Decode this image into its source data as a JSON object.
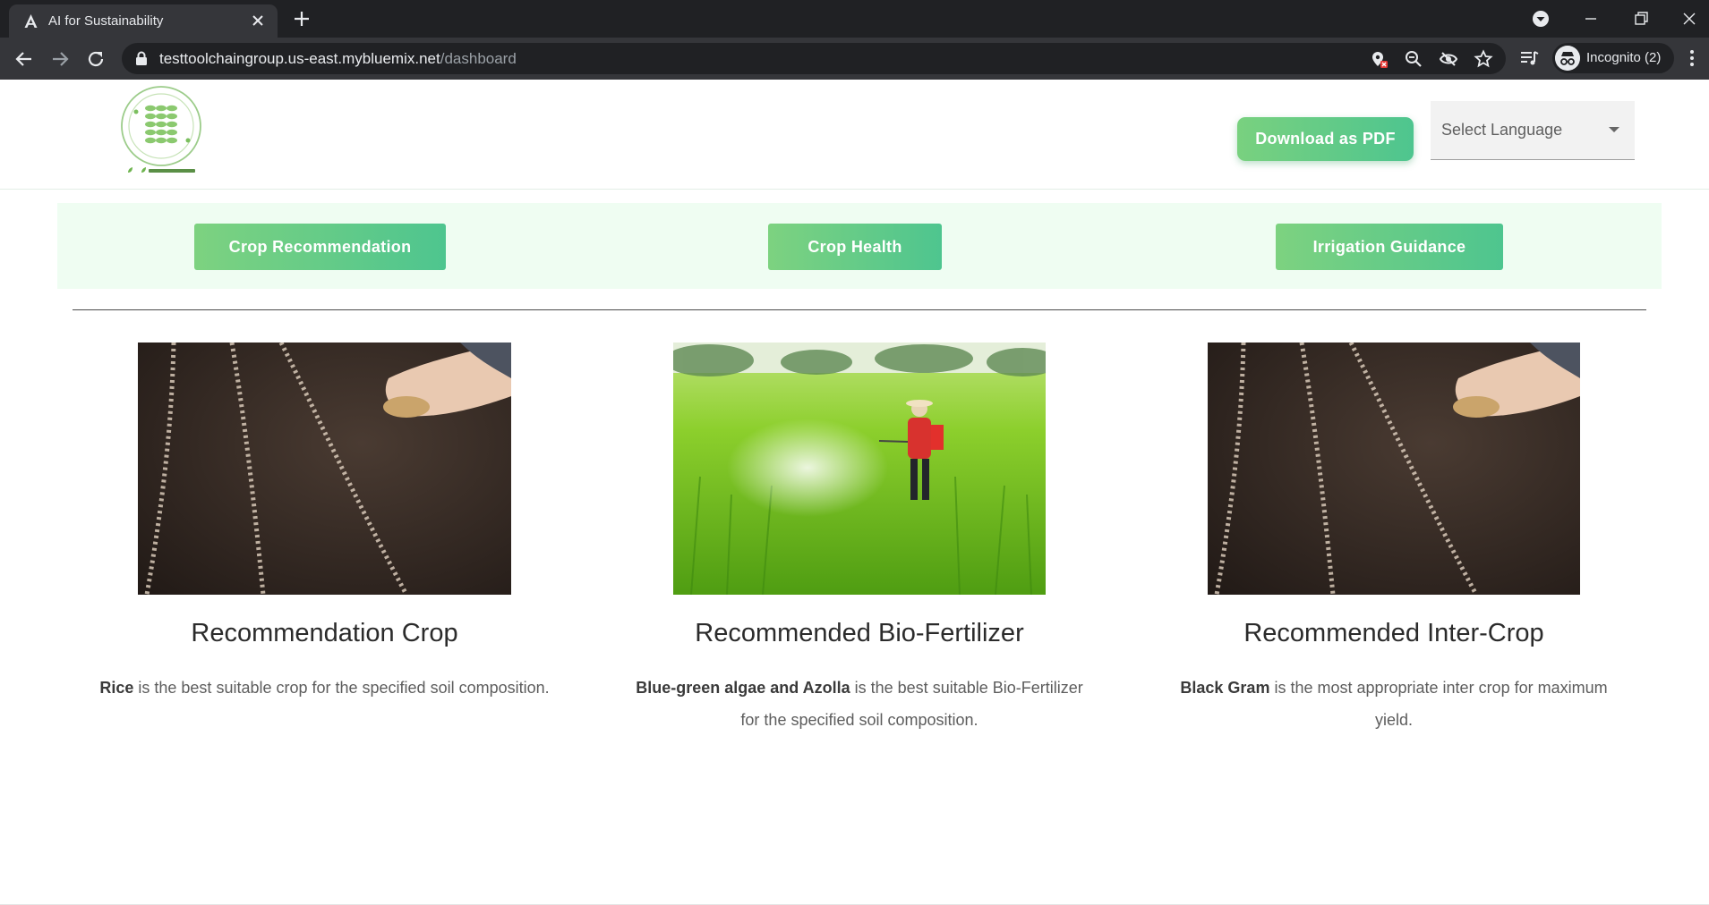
{
  "browser": {
    "tab_title": "AI for Sustainability",
    "url_host": "testtoolchaingroup.us-east.mybluemix.net",
    "url_path": "/dashboard",
    "incognito_label": "Incognito (2)",
    "icons": {
      "favicon": "logo-a-icon",
      "tab_close": "close-icon",
      "new_tab": "plus-icon",
      "tab_search": "chevron-down-circle-icon",
      "minimize": "minimize-icon",
      "restore": "restore-icon",
      "close_window": "close-icon",
      "back": "arrow-left-icon",
      "forward": "arrow-right-icon",
      "reload": "reload-icon",
      "lock": "lock-icon",
      "location_blocked": "location-blocked-icon",
      "zoom": "zoom-out-icon",
      "tracking_blocked": "eye-off-icon",
      "bookmark": "star-icon",
      "media": "media-queue-icon",
      "incognito": "incognito-icon",
      "menu": "kebab-menu-icon"
    }
  },
  "header": {
    "logo_alt_text": "AGVENTURE",
    "download_label": "Download as PDF",
    "language_placeholder": "Select Language"
  },
  "nav": {
    "tabs": [
      {
        "label": "Crop Recommendation"
      },
      {
        "label": "Crop Health"
      },
      {
        "label": "Irrigation Guidance"
      }
    ]
  },
  "cards": [
    {
      "title": "Recommendation Crop",
      "highlight": "Rice",
      "text": " is the best suitable crop for the specified soil composition.",
      "image": "soil-seeds-hand-photo"
    },
    {
      "title": "Recommended Bio-Fertilizer",
      "highlight": "Blue-green algae and Azolla",
      "text": " is the best suitable Bio-Fertilizer for the specified soil composition.",
      "image": "rice-field-sprayer-photo"
    },
    {
      "title": "Recommended Inter-Crop",
      "highlight": "Black Gram",
      "text": " is the most appropriate inter crop for maximum yield.",
      "image": "soil-seeds-hand-photo"
    }
  ],
  "colors": {
    "accent_green_start": "#7dd280",
    "accent_green_end": "#4ec58f",
    "nav_strip_bg": "#effdf2",
    "chrome_dark": "#202124",
    "chrome_toolbar": "#35363a"
  }
}
